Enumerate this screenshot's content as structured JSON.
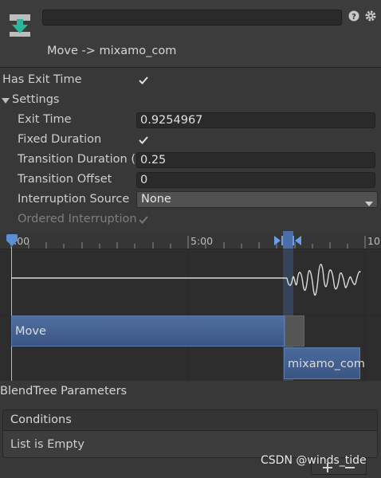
{
  "header": {
    "name_value": "",
    "title": "Move -> mixamo_com",
    "icons": [
      "transition-icon",
      "help-icon",
      "gear-icon"
    ]
  },
  "has_exit_time": {
    "label": "Has Exit Time",
    "checked": true
  },
  "settings": {
    "label": "Settings",
    "expanded": true,
    "exit_time": {
      "label": "Exit Time",
      "value": "0.9254967"
    },
    "fixed_duration": {
      "label": "Fixed Duration",
      "checked": true
    },
    "transition_duration": {
      "label": "Transition Duration (",
      "value": "0.25"
    },
    "transition_offset": {
      "label": "Transition Offset",
      "value": "0"
    },
    "interruption_source": {
      "label": "Interruption Source",
      "value": "None"
    },
    "ordered_interruption": {
      "label": "Ordered Interruption",
      "checked": true,
      "disabled": true
    }
  },
  "timeline": {
    "ticks": [
      ":00",
      "5:00",
      "10"
    ],
    "clips": [
      {
        "label": "Move"
      },
      {
        "label": "mixamo_com"
      }
    ]
  },
  "blend_tree": {
    "label": "BlendTree Parameters"
  },
  "conditions": {
    "title": "Conditions",
    "empty_text": "List is Empty"
  },
  "watermark": "CSDN @winds_tide",
  "colors": {
    "accent": "#3b5583",
    "background": "#383838",
    "timeline_bg": "#2d2d2d"
  }
}
